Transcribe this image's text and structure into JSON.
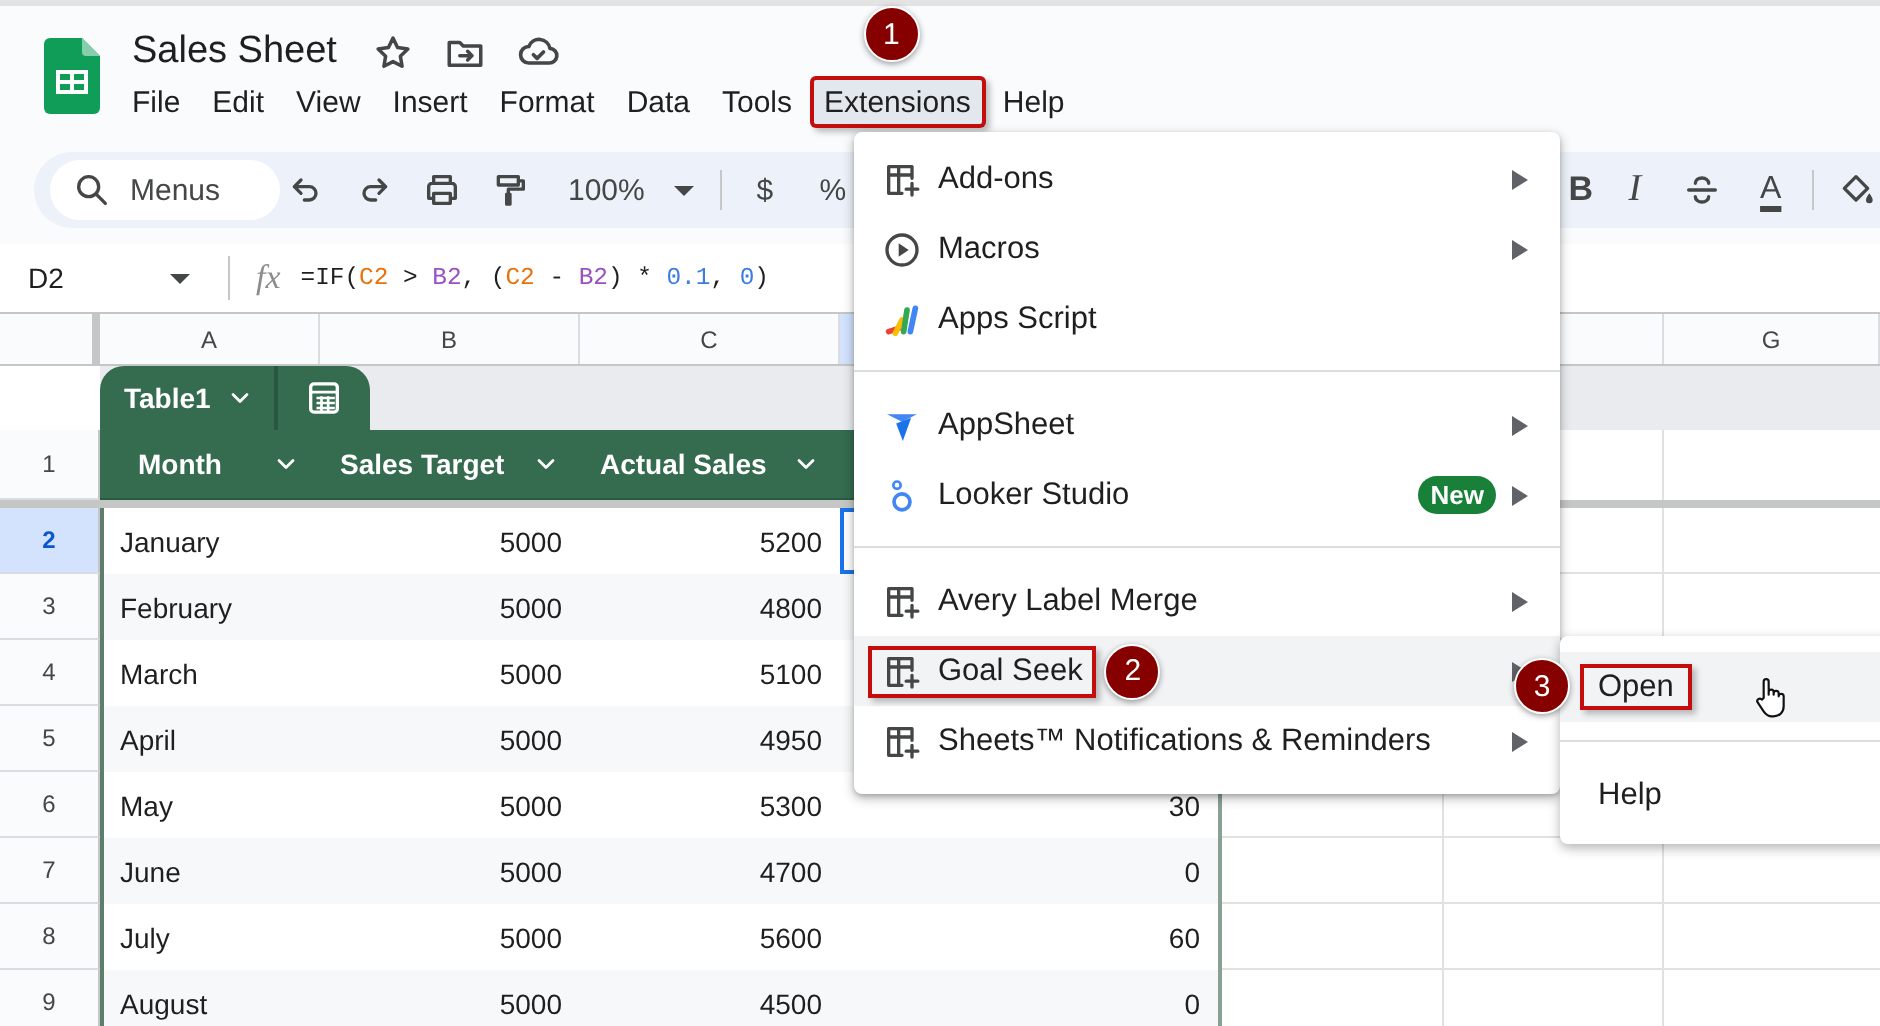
{
  "document": {
    "title": "Sales Sheet"
  },
  "menu_bar": [
    {
      "label": "File",
      "selected": false
    },
    {
      "label": "Edit",
      "selected": false
    },
    {
      "label": "View",
      "selected": false
    },
    {
      "label": "Insert",
      "selected": false
    },
    {
      "label": "Format",
      "selected": false
    },
    {
      "label": "Data",
      "selected": false
    },
    {
      "label": "Tools",
      "selected": false
    },
    {
      "label": "Extensions",
      "selected": true,
      "callout": "1"
    },
    {
      "label": "Help",
      "selected": false
    }
  ],
  "toolbar": {
    "search": {
      "placeholder": "Menus"
    },
    "zoom": "100%",
    "currency": "$",
    "percent": "%",
    "bold": "B",
    "italic": "I",
    "text_color": "A"
  },
  "formula_bar": {
    "cell_ref": "D2",
    "fx": "fx",
    "tokens": [
      {
        "text": "=IF(",
        "color": "#1f1f1f"
      },
      {
        "text": "C2",
        "color": "#e8710a"
      },
      {
        "text": " > ",
        "color": "#1f1f1f"
      },
      {
        "text": "B2",
        "color": "#9c4fc0"
      },
      {
        "text": ", (",
        "color": "#1f1f1f"
      },
      {
        "text": "C2",
        "color": "#e8710a"
      },
      {
        "text": " - ",
        "color": "#1f1f1f"
      },
      {
        "text": "B2",
        "color": "#9c4fc0"
      },
      {
        "text": ") * ",
        "color": "#1f1f1f"
      },
      {
        "text": "0.1",
        "color": "#3b7de0"
      },
      {
        "text": ", ",
        "color": "#1f1f1f"
      },
      {
        "text": "0",
        "color": "#3b7de0"
      },
      {
        "text": ")",
        "color": "#1f1f1f"
      }
    ]
  },
  "column_headers": [
    {
      "label": "A",
      "selected": false
    },
    {
      "label": "B",
      "selected": false
    },
    {
      "label": "C",
      "selected": false
    },
    {
      "selected": true
    },
    {
      "selected": false
    },
    {
      "label": "G",
      "selected": false
    }
  ],
  "table": {
    "name": "Table1",
    "header_row": "1",
    "columns": [
      "Month",
      "Sales Target",
      "Actual Sales"
    ],
    "rows": [
      {
        "number": "2",
        "selected": true,
        "cells": [
          "January",
          "5000",
          "5200"
        ]
      },
      {
        "number": "3",
        "selected": false,
        "cells": [
          "February",
          "5000",
          "4800"
        ]
      },
      {
        "number": "4",
        "selected": false,
        "cells": [
          "March",
          "5000",
          "5100"
        ]
      },
      {
        "number": "5",
        "selected": false,
        "cells": [
          "April",
          "5000",
          "4950"
        ]
      },
      {
        "number": "6",
        "selected": false,
        "cells": [
          "May",
          "5000",
          "5300",
          "30"
        ]
      },
      {
        "number": "7",
        "selected": false,
        "cells": [
          "June",
          "5000",
          "4700",
          "0"
        ]
      },
      {
        "number": "8",
        "selected": false,
        "cells": [
          "July",
          "5000",
          "5600",
          "60"
        ]
      },
      {
        "number": "9",
        "selected": false,
        "cells": [
          "August",
          "5000",
          "4500",
          "0"
        ]
      }
    ]
  },
  "extensions_menu": {
    "groups": [
      [
        {
          "kind": "add-on",
          "label": "Add-ons",
          "submenu": true,
          "selected": false
        },
        {
          "kind": "macro",
          "label": "Macros",
          "submenu": true,
          "selected": false
        },
        {
          "kind": "script",
          "label": "Apps Script",
          "submenu": false,
          "selected": false
        }
      ],
      [
        {
          "kind": "appsheet",
          "label": "AppSheet",
          "submenu": true,
          "selected": false
        },
        {
          "kind": "looker",
          "label": "Looker Studio",
          "badge": "New",
          "submenu": true,
          "selected": false
        }
      ],
      [
        {
          "kind": "add-on",
          "label": "Avery Label Merge",
          "submenu": true,
          "selected": false
        },
        {
          "kind": "add-on",
          "label": "Goal Seek",
          "submenu": true,
          "selected": true,
          "callout": "2"
        },
        {
          "kind": "add-on",
          "label": "Sheets™ Notifications & Reminders",
          "submenu": true,
          "selected": false
        }
      ]
    ]
  },
  "submenu": {
    "items": [
      {
        "label": "Open",
        "selected": true,
        "callout": "3"
      },
      {
        "label": "Help",
        "selected": false
      }
    ]
  }
}
